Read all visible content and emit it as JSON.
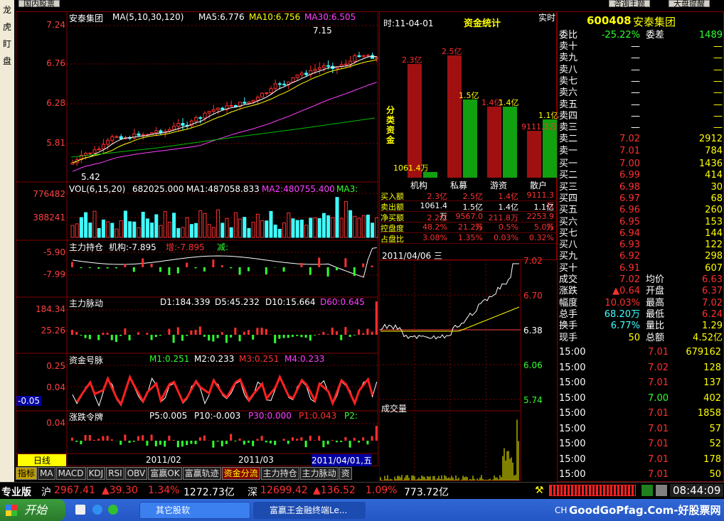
{
  "left_bar": [
    "龙",
    "虎",
    "盯",
    "盘"
  ],
  "top_buttons": {
    "b1": "国内股票",
    "b2": "咨询主题",
    "b3": "大盘提醒"
  },
  "k": {
    "name": "安泰集团",
    "ma_params": "MA(5,10,30,120)",
    "ma5": "MA5:6.776",
    "ma10": "MA10:6.756",
    "ma30": "MA30:6.505",
    "ticks": [
      "7.24",
      "6.76",
      "6.28",
      "5.81"
    ],
    "high": "7.15",
    "low": "5.42"
  },
  "vol": {
    "label": "VOL(6,15,20)",
    "value": "682025.000",
    "ma1": "MA1:487058.833",
    "ma2": "MA2:480755.400",
    "ma3": "MA3:",
    "ticks": [
      "776482",
      "388241"
    ]
  },
  "zlcc": {
    "label": "主力持仓",
    "jg": "机构:-7.895",
    "zeng": "增:-7.895",
    "jian": "减:",
    "ticks": [
      "-5.90",
      "-7.99"
    ]
  },
  "zlmd": {
    "label": "主力脉动",
    "d1": "D1:184.339",
    "d5": "D5:45.232",
    "d10": "D10:15.664",
    "d60": "D60:0.645",
    "ticks": [
      "184.34",
      "25.26"
    ]
  },
  "zjhm": {
    "label": "资金号脉",
    "m1": "M1:0.251",
    "m2": "M2:0.233",
    "m3": "M3:0.251",
    "m4": "M4:0.233",
    "ticks": [
      "0.25",
      "0.04",
      "-0.05"
    ]
  },
  "zdlp": {
    "label": "涨跌令牌",
    "p5": "P5:0.005",
    "p10": "P10:-0.003",
    "p30": "P30:0.000",
    "p1": "P1:0.043",
    "p2": "P2:",
    "ticks": [
      "0.04"
    ]
  },
  "xaxis": {
    "period": "日线",
    "d1": "2011/02",
    "d2": "2011/03",
    "cursor": "2011/04/01,五"
  },
  "tabs": [
    "指标",
    "MA",
    "MACD",
    "KDJ",
    "RSI",
    "OBV",
    "富赢OK",
    "富赢轨迹",
    "资金分流",
    "主力持仓",
    "主力脉动",
    "资"
  ],
  "fund": {
    "time": "时:11-04-01",
    "title": "资金统计",
    "realtime": "实时",
    "side": "分类资金",
    "bars": [
      {
        "name": "机构",
        "buy": "2.3亿",
        "sell": "1061.4万"
      },
      {
        "name": "私募",
        "buy": "2.5亿",
        "sell": "1.5亿"
      },
      {
        "name": "游资",
        "buy": "1.4亿",
        "sell": "1.4亿"
      },
      {
        "name": "散户",
        "buy": "9111.3万",
        "sell": "1.1亿"
      }
    ],
    "rows": [
      {
        "k": "买入额",
        "v": [
          "2.3亿",
          "2.5亿",
          "1.4亿",
          "9111.3万"
        ]
      },
      {
        "k": "卖出额",
        "v": [
          "1061.4万",
          "1.5亿",
          "1.4亿",
          "1.1亿"
        ]
      },
      {
        "k": "净买额",
        "v": [
          "2.2亿",
          "9567.0万",
          "211.8万",
          "2253.9万"
        ]
      },
      {
        "k": "控盘度",
        "v": [
          "48.2%",
          "21.2%",
          "0.5%",
          "5.0%"
        ]
      },
      {
        "k": "占盘比",
        "v": [
          "3.08%",
          "1.35%",
          "0.03%",
          "0.32%"
        ]
      }
    ]
  },
  "intraday": {
    "date": "2011/04/06 三",
    "ticks": [
      "7.02",
      "6.70",
      "6.38",
      "6.06",
      "5.74"
    ],
    "vol_label": "成交量"
  },
  "quote": {
    "code": "600408",
    "name": "安泰集团",
    "wb_k": "委比",
    "wb_v": "-25.22%",
    "wc_k": "委差",
    "wc_v": "1489",
    "sells": [
      {
        "k": "卖十",
        "p": "—",
        "v": "—"
      },
      {
        "k": "卖九",
        "p": "—",
        "v": "—"
      },
      {
        "k": "卖八",
        "p": "—",
        "v": "—"
      },
      {
        "k": "卖七",
        "p": "—",
        "v": "—"
      },
      {
        "k": "卖六",
        "p": "—",
        "v": "—"
      },
      {
        "k": "卖五",
        "p": "—",
        "v": "—"
      },
      {
        "k": "卖四",
        "p": "—",
        "v": "—"
      },
      {
        "k": "卖三",
        "p": "—",
        "v": "—"
      },
      {
        "k": "卖二",
        "p": "7.02",
        "v": "2912"
      },
      {
        "k": "卖一",
        "p": "7.01",
        "v": "784"
      }
    ],
    "buys": [
      {
        "k": "买一",
        "p": "7.00",
        "v": "1436"
      },
      {
        "k": "买二",
        "p": "6.99",
        "v": "414"
      },
      {
        "k": "买三",
        "p": "6.98",
        "v": "30"
      },
      {
        "k": "买四",
        "p": "6.97",
        "v": "68"
      },
      {
        "k": "买五",
        "p": "6.96",
        "v": "260"
      },
      {
        "k": "买六",
        "p": "6.95",
        "v": "153"
      },
      {
        "k": "买七",
        "p": "6.94",
        "v": "144"
      },
      {
        "k": "买八",
        "p": "6.93",
        "v": "122"
      },
      {
        "k": "买九",
        "p": "6.92",
        "v": "298"
      },
      {
        "k": "买十",
        "p": "6.91",
        "v": "607"
      }
    ],
    "stats": [
      {
        "k1": "成交",
        "v1": "7.02",
        "k2": "均价",
        "v2": "6.63"
      },
      {
        "k1": "涨跌",
        "v1": "▲0.64",
        "k2": "开盘",
        "v2": "6.37"
      },
      {
        "k1": "幅度",
        "v1": "10.03%",
        "k2": "最高",
        "v2": "7.02"
      },
      {
        "k1": "总手",
        "v1": "68.20万",
        "k2": "最低",
        "v2": "6.24"
      },
      {
        "k1": "换手",
        "v1": "6.77%",
        "k2": "量比",
        "v2": "1.29"
      },
      {
        "k1": "现手",
        "v1": "50",
        "k2": "总额",
        "v2": "4.52亿"
      }
    ],
    "ticks": [
      {
        "t": "15:00",
        "p": "7.01",
        "v": "679162"
      },
      {
        "t": "15:00",
        "p": "7.02",
        "v": "128"
      },
      {
        "t": "15:00",
        "p": "7.01",
        "v": "137"
      },
      {
        "t": "15:00",
        "p": "7.00",
        "v": "402"
      },
      {
        "t": "15:00",
        "p": "7.01",
        "v": "1858"
      },
      {
        "t": "15:00",
        "p": "7.01",
        "v": "57"
      },
      {
        "t": "15:00",
        "p": "7.01",
        "v": "52"
      },
      {
        "t": "15:00",
        "p": "7.01",
        "v": "178"
      },
      {
        "t": "15:00",
        "p": "7.01",
        "v": "50"
      }
    ]
  },
  "status": {
    "edition": "专业版",
    "sh": "沪",
    "sh_idx": "2967.41",
    "sh_chg": "▲39.30",
    "sh_pct": "1.34%",
    "sh_amt": "1272.73亿",
    "sz": "深",
    "sz_idx": "12699.42",
    "sz_chg": "▲136.52",
    "sz_pct": "1.09%",
    "sz_amt": "773.72亿",
    "clock": "08:44:09"
  },
  "taskbar": {
    "start": "开始",
    "t1": "其它股软",
    "t2": "富赢王金融终端Le...",
    "lang": "CH",
    "watermark": "GoodGoPfag.Com-好股票网"
  }
}
